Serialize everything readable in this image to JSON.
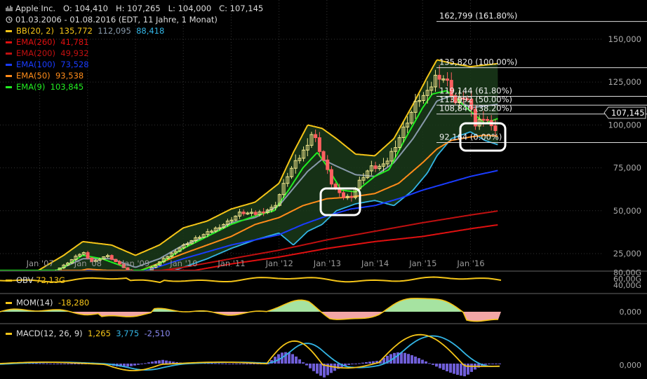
{
  "header": {
    "title": "Apple Inc.",
    "open": "O: 104,410",
    "high": "H: 107,265",
    "low": "L: 104,000",
    "close": "C: 107,145",
    "range": "01.03.2006 - 01.08.2016 (EDT, 11 Jahre, 1 Monat)"
  },
  "legend": [
    {
      "label": "BB(20, 2)",
      "values": [
        "135,772",
        "112,095",
        "88,418"
      ],
      "colors": [
        "#f5c518",
        "#8899aa",
        "#33b5e5"
      ]
    },
    {
      "label": "EMA(260)",
      "values": [
        "41,781"
      ],
      "colors": [
        "#e01010"
      ]
    },
    {
      "label": "EMA(200)",
      "values": [
        "49,932"
      ],
      "colors": [
        "#c01010"
      ]
    },
    {
      "label": "EMA(100)",
      "values": [
        "73,528"
      ],
      "colors": [
        "#1a3cff"
      ]
    },
    {
      "label": "EMA(50)",
      "values": [
        "93,538"
      ],
      "colors": [
        "#ff8c1a"
      ]
    },
    {
      "label": "EMA(9)",
      "values": [
        "103,845"
      ],
      "colors": [
        "#22ee22"
      ]
    }
  ],
  "colors": {
    "bb_upper": "#f5c518",
    "bb_mid": "#8899aa",
    "bb_lower": "#33b5e5",
    "ema260": "#e01010",
    "ema200": "#c01010",
    "ema100": "#1a3cff",
    "ema50": "#ff8c1a",
    "ema9": "#22ee22",
    "candle_up": "#f0e68c",
    "candle_down": "#ff6060",
    "grid": "#333333"
  },
  "fib_levels": [
    {
      "value": 162.799,
      "label": "162,799 (161.80%)"
    },
    {
      "value": 135.82,
      "label": "135,820 (100.00%)"
    },
    {
      "value": 119.144,
      "label": "119,144 (61.80%)"
    },
    {
      "value": 113.992,
      "label": "113,992 (50.00%)"
    },
    {
      "value": 108.84,
      "label": "108,840 (38.20%)"
    },
    {
      "value": 92.164,
      "label": "92,164 (0.00%)"
    }
  ],
  "last_price_label": "107,145",
  "chart_data": {
    "type": "line",
    "title": "Apple Inc.",
    "xlabel": "",
    "ylabel": "",
    "x_ticks": [
      "Jan '07",
      "Jan '08",
      "Jan '09",
      "Jan '10",
      "Jan '11",
      "Jan '12",
      "Jan '13",
      "Jan '14",
      "Jan '15",
      "Jan '16"
    ],
    "x_years": [
      2007,
      2008,
      2009,
      2010,
      2011,
      2012,
      2013,
      2014,
      2015,
      2016
    ],
    "y_ticks": [
      "25,000",
      "50,000",
      "75,000",
      "100,000",
      "125,000",
      "150,000"
    ],
    "ylim": [
      17,
      167
    ],
    "price": {
      "name": "Apple Inc.",
      "t": [
        2006.17,
        2006.5,
        2006.9,
        2007.2,
        2007.5,
        2007.9,
        2008.1,
        2008.4,
        2008.7,
        2009.0,
        2009.2,
        2009.5,
        2009.9,
        2010.2,
        2010.5,
        2010.9,
        2011.2,
        2011.5,
        2011.9,
        2012.2,
        2012.5,
        2012.7,
        2012.9,
        2013.1,
        2013.3,
        2013.5,
        2013.7,
        2013.9,
        2014.2,
        2014.5,
        2014.9,
        2015.1,
        2015.3,
        2015.5,
        2015.7,
        2015.9,
        2016.1,
        2016.3,
        2016.5,
        2016.58
      ],
      "v": [
        10,
        8,
        12,
        13,
        18,
        26,
        20,
        24,
        18,
        12,
        14,
        20,
        28,
        33,
        37,
        43,
        49,
        48,
        52,
        72,
        84,
        96,
        82,
        66,
        58,
        58,
        68,
        75,
        76,
        92,
        115,
        118,
        130,
        126,
        112,
        118,
        100,
        106,
        95,
        107.1
      ]
    },
    "series": [
      {
        "name": "BB(20, 2)",
        "t": [
          2006.17,
          2006.9,
          2007.5,
          2007.9,
          2008.5,
          2009.0,
          2009.5,
          2010.0,
          2010.5,
          2011.0,
          2011.5,
          2012.0,
          2012.3,
          2012.6,
          2012.9,
          2013.2,
          2013.6,
          2014.0,
          2014.4,
          2014.8,
          2015.1,
          2015.3,
          2015.6,
          2016.0,
          2016.58
        ],
        "v": [
          12,
          14,
          24,
          32,
          30,
          24,
          30,
          40,
          44,
          51,
          55,
          66,
          84,
          100,
          98,
          92,
          83,
          82,
          92,
          112,
          128,
          138,
          136,
          134,
          135.8
        ]
      },
      {
        "name": "BB(20, 2) mid",
        "t": [
          2006.17,
          2006.9,
          2007.5,
          2007.9,
          2008.5,
          2009.0,
          2009.5,
          2010.0,
          2010.5,
          2011.0,
          2011.5,
          2012.0,
          2012.3,
          2012.6,
          2012.9,
          2013.2,
          2013.6,
          2014.0,
          2014.4,
          2014.8,
          2015.1,
          2015.3,
          2015.6,
          2016.0,
          2016.58
        ],
        "v": [
          9,
          10,
          17,
          22,
          22,
          17,
          22,
          30,
          35,
          43,
          46,
          53,
          63,
          73,
          80,
          76,
          71,
          70,
          78,
          92,
          105,
          114,
          117,
          110,
          112.1
        ]
      },
      {
        "name": "BB(20, 2) lower",
        "t": [
          2006.17,
          2006.9,
          2007.5,
          2007.9,
          2008.5,
          2009.0,
          2009.5,
          2010.0,
          2010.5,
          2011.0,
          2011.5,
          2012.0,
          2012.3,
          2012.6,
          2012.9,
          2013.2,
          2013.6,
          2014.0,
          2014.4,
          2014.8,
          2015.1,
          2015.3,
          2015.6,
          2016.0,
          2016.3,
          2016.58
        ],
        "v": [
          6,
          7,
          10,
          13,
          13,
          9,
          12,
          17,
          22,
          28,
          33,
          37,
          30,
          38,
          42,
          50,
          54,
          56,
          53,
          62,
          72,
          82,
          92,
          96,
          91,
          88.4
        ]
      },
      {
        "name": "EMA(260)",
        "t": [
          2006.17,
          2008.0,
          2010.0,
          2011.0,
          2012.0,
          2013.0,
          2014.0,
          2015.0,
          2016.0,
          2016.58
        ],
        "v": [
          5,
          8,
          14,
          19,
          23,
          28,
          32,
          35,
          39.5,
          41.8
        ]
      },
      {
        "name": "EMA(200)",
        "t": [
          2006.17,
          2008.0,
          2010.0,
          2011.0,
          2012.0,
          2013.0,
          2014.0,
          2015.0,
          2016.0,
          2016.58
        ],
        "v": [
          5,
          9,
          17,
          22,
          27,
          33,
          38,
          43,
          47.5,
          49.9
        ]
      },
      {
        "name": "EMA(100)",
        "t": [
          2006.17,
          2008.0,
          2009.0,
          2010.0,
          2011.0,
          2012.0,
          2012.5,
          2013.0,
          2013.5,
          2014.0,
          2014.5,
          2015.0,
          2015.5,
          2016.0,
          2016.58
        ],
        "v": [
          6,
          12,
          13,
          22,
          30,
          36,
          42,
          47,
          51,
          53,
          57,
          62,
          66,
          70,
          73.5
        ]
      },
      {
        "name": "EMA(50)",
        "t": [
          2006.17,
          2007.0,
          2008.0,
          2009.0,
          2010.0,
          2011.0,
          2011.5,
          2012.0,
          2012.5,
          2013.0,
          2013.5,
          2014.0,
          2014.5,
          2015.0,
          2015.3,
          2015.6,
          2016.0,
          2016.3,
          2016.58
        ],
        "v": [
          7,
          10,
          16,
          14,
          25,
          35,
          42,
          46,
          53,
          57,
          58,
          60,
          66,
          78,
          86,
          91,
          93,
          94,
          93.5
        ]
      },
      {
        "name": "EMA(9)",
        "t": [
          2006.17,
          2006.9,
          2007.5,
          2007.9,
          2008.3,
          2008.7,
          2009.0,
          2009.5,
          2010.0,
          2010.5,
          2011.0,
          2011.5,
          2011.9,
          2012.2,
          2012.5,
          2012.8,
          2013.0,
          2013.3,
          2013.6,
          2014.0,
          2014.3,
          2014.6,
          2015.0,
          2015.2,
          2015.5,
          2015.8,
          2016.0,
          2016.3,
          2016.58
        ],
        "v": [
          10,
          10,
          17,
          24,
          22,
          18,
          14,
          19,
          28,
          35,
          42,
          47,
          50,
          62,
          75,
          84,
          76,
          62,
          61,
          70,
          74,
          90,
          110,
          118,
          120,
          113,
          108,
          101,
          103.8
        ]
      }
    ]
  },
  "obv": {
    "label": "OBV",
    "value": "72,13G",
    "ticks": [
      "80,00G",
      "60,00G",
      "40,00G"
    ]
  },
  "mom": {
    "label": "MOM(14)",
    "value": "-18,280",
    "ticks": [
      "0,000"
    ]
  },
  "macd": {
    "label": "MACD(12, 26, 9)",
    "values": [
      "1,265",
      "3,775",
      "-2,510"
    ],
    "ticks": [
      "0,000"
    ]
  }
}
